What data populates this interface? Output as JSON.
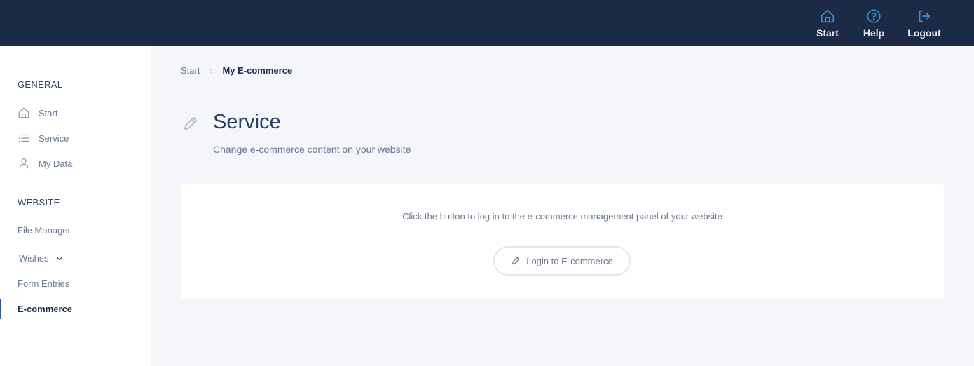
{
  "topbar": {
    "start_label": "Start",
    "help_label": "Help",
    "logout_label": "Logout",
    "icon_color": "#3a8fd6"
  },
  "sidebar": {
    "general_title": "GENERAL",
    "general_items": [
      {
        "label": "Start",
        "icon": "home-icon"
      },
      {
        "label": "Service",
        "icon": "list-icon"
      },
      {
        "label": "My Data",
        "icon": "user-icon"
      }
    ],
    "website_title": "WEBSITE",
    "website_items": [
      {
        "label": "File Manager"
      },
      {
        "label": "Wishes",
        "icon": "chevron-down-icon"
      },
      {
        "label": "Form Entries"
      },
      {
        "label": "E-commerce",
        "active": true
      }
    ]
  },
  "breadcrumb": {
    "root": "Start",
    "separator": "›",
    "current": "My E-commerce"
  },
  "page": {
    "title": "Service",
    "subtitle": "Change e-commerce content on your website"
  },
  "card": {
    "text": "Click the button to log in to the e-commerce management panel of your website",
    "button_label": "Login to E-commerce"
  }
}
